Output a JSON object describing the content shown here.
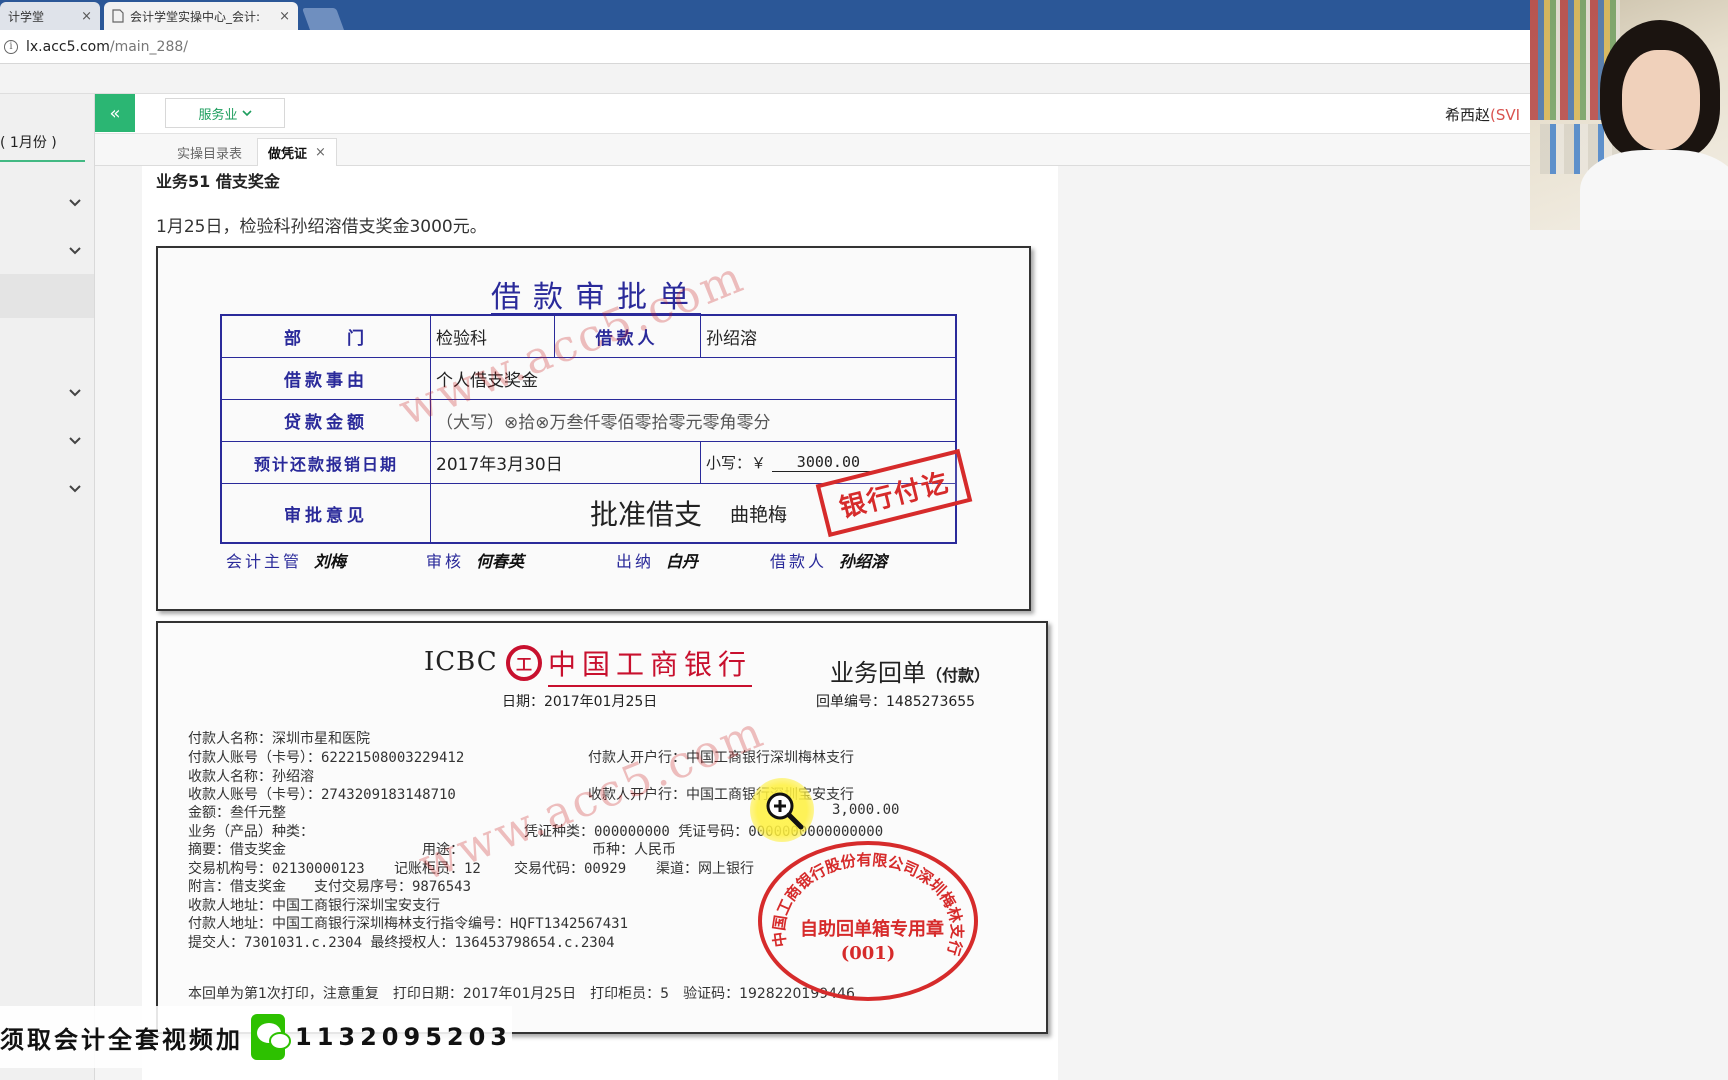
{
  "browser": {
    "tabs": [
      {
        "title": "计学堂",
        "close": "×"
      },
      {
        "title": "会计学堂实操中心_会计:",
        "close": "×"
      }
    ],
    "url_host": "lx.acc5.com",
    "url_path": "/main_288/"
  },
  "app": {
    "collapse_icon": "«",
    "industry_label": "服务业",
    "user_name": "希西赵",
    "user_level": "(SVI",
    "sidebar_title": "( 1月份 )",
    "tabs": [
      {
        "label": "实操目录表"
      },
      {
        "label": "做凭证",
        "close": "×"
      }
    ]
  },
  "business": {
    "title": "业务51 借支奖金",
    "description": "1月25日，检验科孙绍溶借支奖金3000元。"
  },
  "loan_form": {
    "title": "借款审批单",
    "rows": {
      "dept_label": "部　　门",
      "dept_value": "检验科",
      "borrower_label": "借款人",
      "borrower_value": "孙绍溶",
      "reason_label": "借款事由",
      "reason_value": "个人借支奖金",
      "amount_label": "贷款金额",
      "amount_value": "（大写）⊗拾⊗万叁仟零佰零拾零元零角零分",
      "repay_label": "预计还款报销日期",
      "repay_value": "2017年3月30日",
      "small_label": "小写：￥",
      "small_value": "3000.00",
      "approve_label": "审批意见",
      "approve_value": "批准借支",
      "approver_name": "曲艳梅"
    },
    "stamp": "银行付讫",
    "signatures": [
      {
        "label": "会计主管",
        "name": "刘梅"
      },
      {
        "label": "审核",
        "name": "何春英"
      },
      {
        "label": "出纳",
        "name": "白丹"
      },
      {
        "label": "借款人",
        "name": "孙绍溶"
      }
    ]
  },
  "receipt": {
    "icbc": "ICBC",
    "logo_char": "工",
    "bank_name": "中国工商银行",
    "type": "业务回单",
    "type_sub": "（付款）",
    "date": "日期：2017年01月25日",
    "number": "回单编号：1485273655",
    "lines": {
      "l1": "付款人名称：深圳市星和医院",
      "l2a": "付款人账号（卡号）：622215080032294​12",
      "l2b": "付款人开户行：中国工商银行深圳梅林支行",
      "l3": "收款人名称：孙绍溶",
      "l4a": "收款人账号（卡号）：2743209183148710",
      "l4b": "收款人开户行：中国工商银行深圳宝安支行",
      "l5a": "金额：叁仟元整",
      "l5b": "3,000.00",
      "l6a": "业务（产品）种类：",
      "l6b": "凭证种类：000000000 凭证号码：0000000000000000",
      "l7a": "摘要：借支奖金",
      "l7b": "用途：",
      "l7c": "币种：人民币",
      "l8a": "交易机构号：02130000123",
      "l8b": "记账柜员：12",
      "l8c": "交易代码：00929",
      "l8d": "渠道：网上银行",
      "l9": "附言：借支奖金　　支付交易序号：9876543",
      "l10": "收款人地址：中国工商银行深圳宝安支行",
      "l11": "付款人地址：中国工商银行深圳梅林支行指令编号：HQFT1342567431",
      "l12": "提交人：7301031.c.2304 最终授权人：136453798654.c.2304"
    },
    "footer": "本回单为第1次打印，注意重复　打印日期：2017年01月25日　打印柜员：5　验证码：1928220199446",
    "stamp_arc": "中国工商银行股份有限公司深圳梅林支行",
    "stamp_mid": "自助回单箱专用章",
    "stamp_num": "(001)"
  },
  "watermark": "www.acc5.com",
  "promo": {
    "text": "须取会计全套视频加",
    "number": "1132095203"
  }
}
